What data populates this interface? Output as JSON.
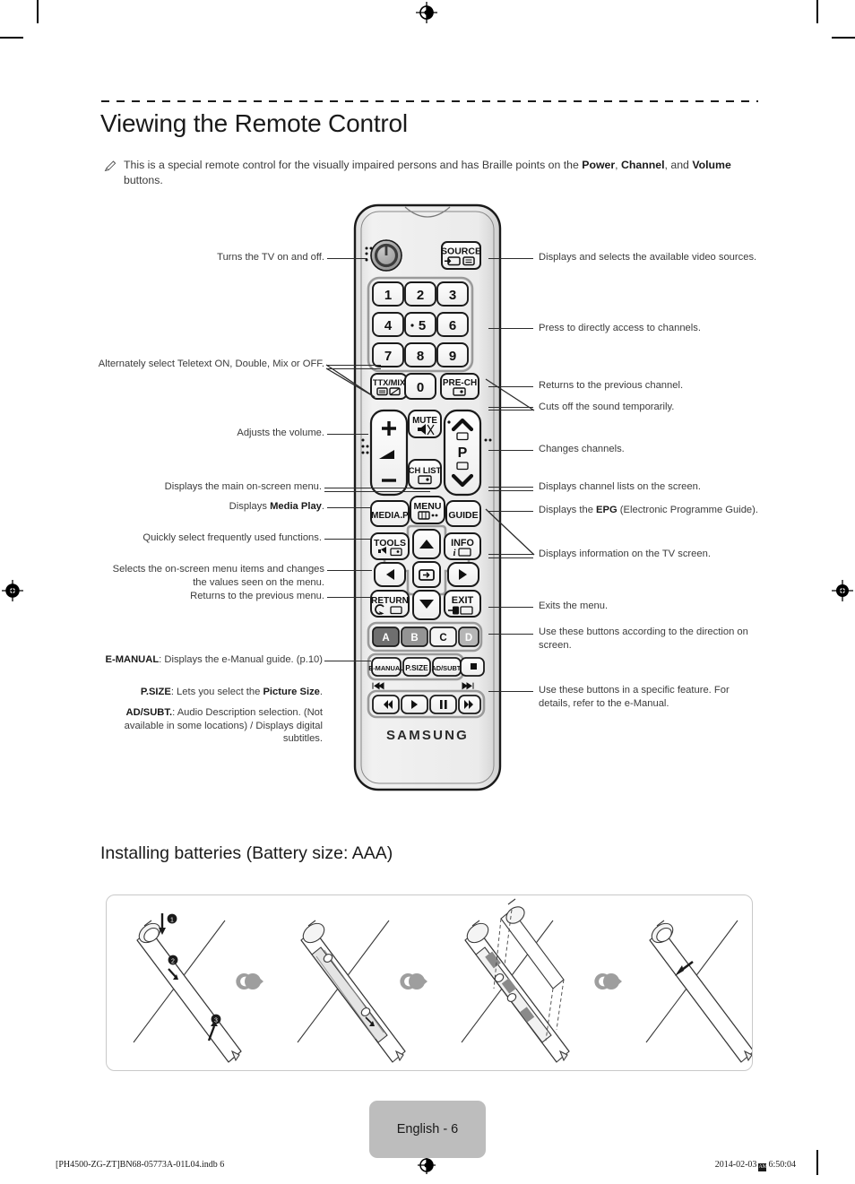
{
  "page": {
    "title": "Viewing the Remote Control",
    "note": "This is a special remote control for the visually impaired persons and has Braille points on the ",
    "note_b1": "Power",
    "note_mid": ", ",
    "note_b2": "Channel",
    "note_tail": ", and ",
    "note_b3": "Volume",
    "note_end": " buttons.",
    "note_icon": "pencil-note-icon"
  },
  "callouts_left": [
    {
      "id": "power",
      "text": "Turns the TV on and off."
    },
    {
      "id": "ttxmix",
      "text": "Alternately select Teletext ON, Double, Mix or OFF."
    },
    {
      "id": "volume",
      "text": "Adjusts the volume."
    },
    {
      "id": "menu",
      "text": "Displays the main on-screen menu."
    },
    {
      "id": "media-p",
      "text_a": "Displays ",
      "text_b": "Media Play",
      "text_c": "."
    },
    {
      "id": "tools",
      "text": "Quickly select frequently used functions."
    },
    {
      "id": "arrows",
      "text": "Selects the on-screen menu items and changes the values seen on the menu."
    },
    {
      "id": "return",
      "text": "Returns to the previous menu."
    },
    {
      "id": "e-manual",
      "text_a": "E-MANUAL",
      "text_b": ": Displays the e-Manual guide. (p.10)"
    },
    {
      "id": "p-size",
      "text_a": "P.SIZE",
      "text_b": ": Lets you select the ",
      "text_c": "Picture Size",
      "text_d": "."
    },
    {
      "id": "ad-subt",
      "text_a": "AD/SUBT.",
      "text_b": ": Audio Description selection. (Not available in some locations) / Displays digital subtitles."
    }
  ],
  "callouts_right": [
    {
      "id": "source",
      "text": "Displays and selects the available video sources."
    },
    {
      "id": "numbers",
      "text": "Press to directly access to channels."
    },
    {
      "id": "pre-ch",
      "text": "Returns to the previous channel."
    },
    {
      "id": "mute",
      "text": "Cuts off the sound temporarily."
    },
    {
      "id": "channel",
      "text": "Changes channels."
    },
    {
      "id": "ch-list",
      "text": "Displays channel lists on the screen."
    },
    {
      "id": "guide",
      "text_a": "Displays the ",
      "text_b": "EPG",
      "text_c": " (Electronic Programme Guide)."
    },
    {
      "id": "info",
      "text": "Displays information on the TV screen."
    },
    {
      "id": "exit",
      "text": "Exits the menu."
    },
    {
      "id": "color",
      "text": "Use these buttons according to the direction on screen."
    },
    {
      "id": "media",
      "text": "Use these buttons in a specific feature. For details, refer to the e-Manual."
    }
  ],
  "remote": {
    "brand": "SAMSUNG",
    "buttons": {
      "power": "power-icon",
      "source": "SOURCE",
      "num1": "1",
      "num2": "2",
      "num3": "3",
      "num4": "4",
      "num5": "5",
      "num6": "6",
      "num7": "7",
      "num8": "8",
      "num9": "9",
      "num0": "0",
      "ttxmix": "TTX/MIX",
      "prech": "PRE-CH",
      "mute": "MUTE",
      "chlist": "CH LIST",
      "vol_plus": "+",
      "vol_minus": "–",
      "p_label": "P",
      "mediap": "MEDIA.P",
      "menu": "MENU",
      "guide": "GUIDE",
      "tools": "TOOLS",
      "info": "INFO",
      "return": "RETURN",
      "exit": "EXIT",
      "color_a": "A",
      "color_b": "B",
      "color_c": "C",
      "color_d": "D",
      "emanual": "E-MANUAL",
      "psize": "P.SIZE",
      "adsubt": "AD/SUBT."
    },
    "colors": {
      "body": "#e8e8e8",
      "a_btn": "#6f6f6f",
      "b_btn": "#949494",
      "c_btn": "#f2f2f2",
      "d_btn": "#b5b5b5"
    }
  },
  "battery": {
    "title": "Installing batteries (Battery size: AAA)",
    "steps": [
      "1",
      "2",
      "3"
    ]
  },
  "footer": {
    "page_label": "English - 6",
    "file": "[PH4500-ZG-ZT]BN68-05773A-01L04.indb   6",
    "date": "2014-02-03",
    "time": "6:50:04"
  }
}
